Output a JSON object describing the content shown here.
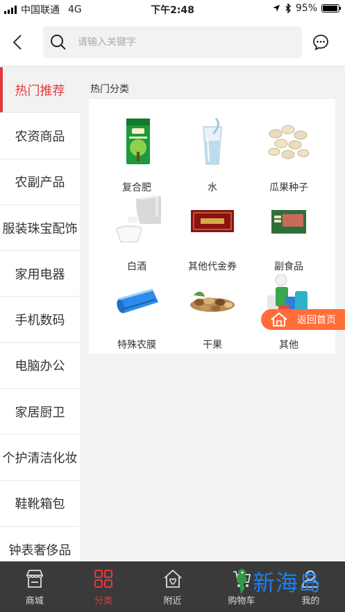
{
  "status_bar": {
    "carrier": "中国联通",
    "network": "4G",
    "time": "下午2:48",
    "battery_text": "95%",
    "battery_level": 0.95
  },
  "header": {
    "search_placeholder": "请输入关键字"
  },
  "sidebar": {
    "items": [
      {
        "label": "热门推荐",
        "active": true
      },
      {
        "label": "农资商品"
      },
      {
        "label": "农副产品"
      },
      {
        "label": "服装珠宝配饰"
      },
      {
        "label": "家用电器"
      },
      {
        "label": "手机数码"
      },
      {
        "label": "电脑办公"
      },
      {
        "label": "家居厨卫"
      },
      {
        "label": "个护清洁化妆"
      },
      {
        "label": "鞋靴箱包"
      },
      {
        "label": "钟表奢侈品"
      }
    ]
  },
  "content": {
    "section_title": "热门分类",
    "categories": [
      {
        "label": "复合肥",
        "icon": "fertilizer-bag-image"
      },
      {
        "label": "水",
        "icon": "water-glass-image"
      },
      {
        "label": "瓜果种子",
        "icon": "seeds-image"
      },
      {
        "label": "白酒",
        "icon": "liquor-bottle-image"
      },
      {
        "label": "其他代金券",
        "icon": "voucher-image"
      },
      {
        "label": "副食品",
        "icon": "food-box-image"
      },
      {
        "label": "特殊农膜",
        "icon": "film-roll-image"
      },
      {
        "label": "干果",
        "icon": "nuts-image"
      },
      {
        "label": "其他",
        "icon": "yarn-spools-image"
      }
    ]
  },
  "float_button": {
    "label": "返回首页"
  },
  "tabbar": {
    "tabs": [
      {
        "label": "商城",
        "icon": "store-icon"
      },
      {
        "label": "分类",
        "icon": "grid-icon",
        "active": true
      },
      {
        "label": "附近",
        "icon": "home-heart-icon"
      },
      {
        "label": "购物车",
        "icon": "cart-icon"
      },
      {
        "label": "我的",
        "icon": "user-icon"
      }
    ]
  },
  "watermark": {
    "text": "新海岛"
  },
  "colors": {
    "accent": "#e4393c",
    "float_button": "#ff6d3a",
    "tabbar_bg": "#3a3a3a",
    "watermark": "#1e7fe6"
  }
}
